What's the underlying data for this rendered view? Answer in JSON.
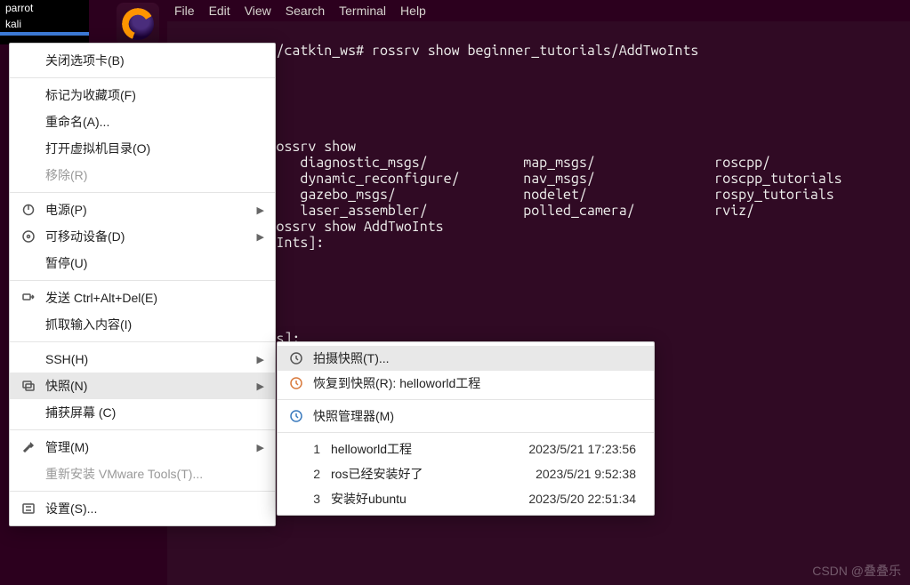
{
  "sidebar": {
    "tabs": [
      "parrot",
      "kali"
    ]
  },
  "menubar": [
    "File",
    "Edit",
    "View",
    "Search",
    "Terminal",
    "Help"
  ],
  "terminal_lines": [
    "root@ubuntu:~/catkin_ws# rossrv show beginner_tutorials/AddTwoInts",
    "",
    "",
    "",
    "",
    "",
    "/catkin_ws# rossrv show ",
    "rials/          diagnostic_msgs/            map_msgs/               roscpp/",
    "nager_msgs/     dynamic_reconfigure/        nav_msgs/               roscpp_tutorials",
    "                gazebo_msgs/                nodelet/                rospy_tutorials",
    "ox/             laser_assembler/            polled_camera/          rviz/",
    "/catkin_ws# rossrv show AddTwoInts",
    "orials/AddTwoInts]:",
    "",
    "",
    "",
    "",
    "",
    "als/AddTwoInts]:"
  ],
  "context_menu": {
    "close_tab": "关闭选项卡(B)",
    "mark_favorite": "标记为收藏项(F)",
    "rename": "重命名(A)...",
    "open_vm_dir": "打开虚拟机目录(O)",
    "remove": "移除(R)",
    "power": "电源(P)",
    "removable": "可移动设备(D)",
    "pause": "暂停(U)",
    "send_cad": "发送 Ctrl+Alt+Del(E)",
    "grab_input": "抓取输入内容(I)",
    "ssh": "SSH(H)",
    "snapshot": "快照(N)",
    "capture_screen": "捕获屏幕 (C)",
    "manage": "管理(M)",
    "reinstall_tools": "重新安装 VMware Tools(T)...",
    "settings": "设置(S)..."
  },
  "submenu": {
    "take_snapshot": "拍摄快照(T)...",
    "revert_snapshot": "恢复到快照(R): helloworld工程",
    "snapshot_manager": "快照管理器(M)",
    "snapshots": [
      {
        "num": "1",
        "name": "helloworld工程",
        "time": "2023/5/21 17:23:56"
      },
      {
        "num": "2",
        "name": "ros已经安装好了",
        "time": "2023/5/21 9:52:38"
      },
      {
        "num": "3",
        "name": "安装好ubuntu",
        "time": "2023/5/20 22:51:34"
      }
    ]
  },
  "watermark": "CSDN @叠叠乐"
}
